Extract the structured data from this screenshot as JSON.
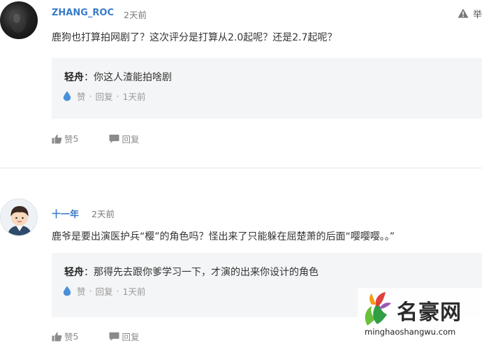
{
  "comments": [
    {
      "username": "ZHANG_ROC",
      "time": "2天前",
      "report_label": "举",
      "text": "鹿狗也打算拍网剧了？这次评分是打算从2.0起呢？还是2.7起呢？",
      "reply": {
        "author": "轻舟",
        "colon": "：",
        "text": "你这人渣能拍啥剧",
        "like_label": "赞",
        "reply_label": "回复",
        "sep": "·",
        "time": "1天前"
      },
      "actions": {
        "like_label": "赞",
        "like_count": "5",
        "reply_label": "回复"
      }
    },
    {
      "username": "十一年",
      "time": "2天前",
      "text": "鹿爷是要出演医护兵“樱”的角色吗？怪出来了只能躲在屈楚萧的后面“嘤嘤嘤。。”",
      "reply": {
        "author": "轻舟",
        "colon": "：",
        "text": "那得先去跟你爹学习一下，才演的出来你设计的角色",
        "like_label": "赞",
        "reply_label": "回复",
        "sep": "·",
        "time": "1天前"
      },
      "actions": {
        "like_label": "赞",
        "like_count": "5",
        "reply_label": "回复"
      }
    }
  ],
  "watermark": {
    "title": "名豪网",
    "url": "minghaoshangwu.com"
  },
  "colors": {
    "username": "#3a7cc7",
    "reply_box_bg": "#f4f5f6",
    "like_drop": "#4a90d9",
    "meta_gray": "#999999"
  },
  "icons": [
    "warning-icon",
    "water-drop-icon",
    "thumbs-up-icon",
    "speech-bubble-icon"
  ]
}
